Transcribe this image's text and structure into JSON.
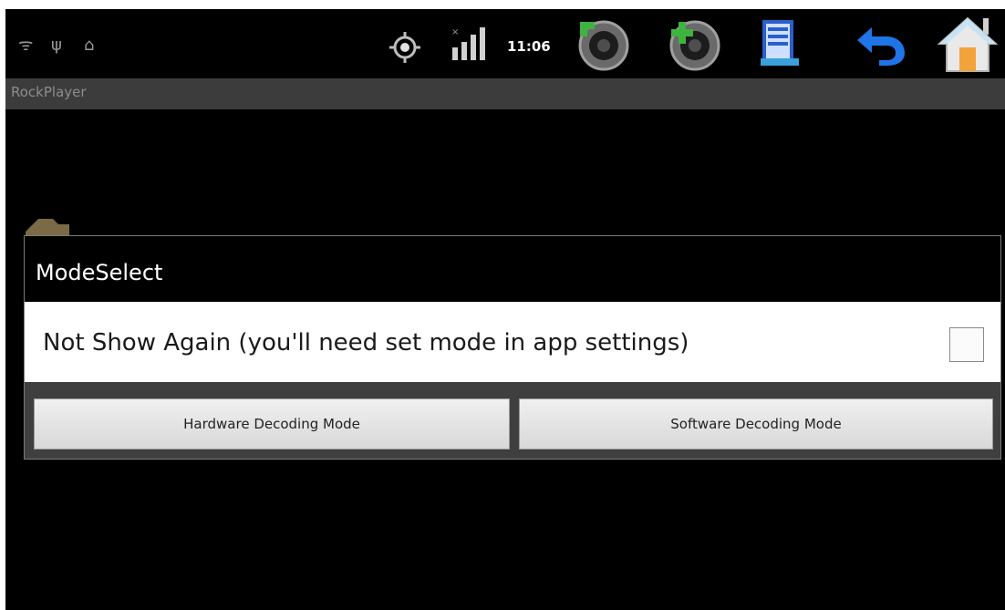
{
  "status_bar": {
    "clock": "11:06",
    "left_icons": [
      "wifi-icon",
      "usb-icon",
      "android-debug-icon"
    ],
    "right_icons": [
      "gps-icon",
      "signal-icon",
      "volume-down-icon",
      "volume-up-icon",
      "menu-icon",
      "back-icon",
      "home-icon"
    ]
  },
  "app": {
    "title": "RockPlayer"
  },
  "dialog": {
    "title": "ModeSelect",
    "option_label": "Not Show Again (you'll need set mode in app settings)",
    "option_checked": false,
    "hardware_button": "Hardware Decoding Mode",
    "software_button": "Software Decoding Mode"
  },
  "colors": {
    "screen_bg": "#000000",
    "title_bar_bg": "#3c3c3c",
    "dialog_header_bg": "#000000",
    "dialog_body_bg": "#ffffff",
    "button_bg": "#e6e6e6",
    "back_icon": "#1f74e8",
    "home_icon": "#f2a33a"
  }
}
